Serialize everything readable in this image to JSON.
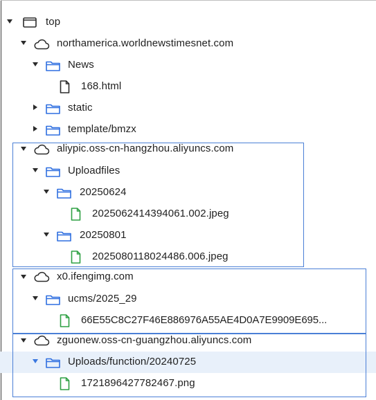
{
  "tree": {
    "root": {
      "label": "top"
    },
    "hosts": [
      {
        "label": "northamerica.worldnewstimesnet.com",
        "folders": [
          {
            "label": "News",
            "files": [
              "168.html"
            ]
          },
          {
            "label": "static",
            "collapsed": true
          },
          {
            "label": "template/bmzx",
            "collapsed": true
          }
        ]
      },
      {
        "label": "aliypic.oss-cn-hangzhou.aliyuncs.com",
        "folders": [
          {
            "label": "Uploadfiles"
          },
          {
            "label": "20250624",
            "files": [
              "2025062414394061.002.jpeg"
            ]
          },
          {
            "label": "20250801",
            "files": [
              "2025080118024486.006.jpeg"
            ]
          }
        ]
      },
      {
        "label": "x0.ifengimg.com",
        "folders": [
          {
            "label": "ucms/2025_29",
            "files": [
              "66E55C8C27F46E886976A55AE4D0A7E9909E695..."
            ]
          }
        ]
      },
      {
        "label": "zguonew.oss-cn-guangzhou.aliyuncs.com",
        "folders": [
          {
            "label": "Uploads/function/20240725",
            "selected": true,
            "files": [
              "1721896427782467.png"
            ]
          }
        ]
      }
    ]
  },
  "colors": {
    "folder": "#2f6fe0",
    "image_file": "#2ea043",
    "generic_file": "#2b2b2b",
    "selection": "#e8f0fa",
    "group_box": "#4a7fd6"
  }
}
